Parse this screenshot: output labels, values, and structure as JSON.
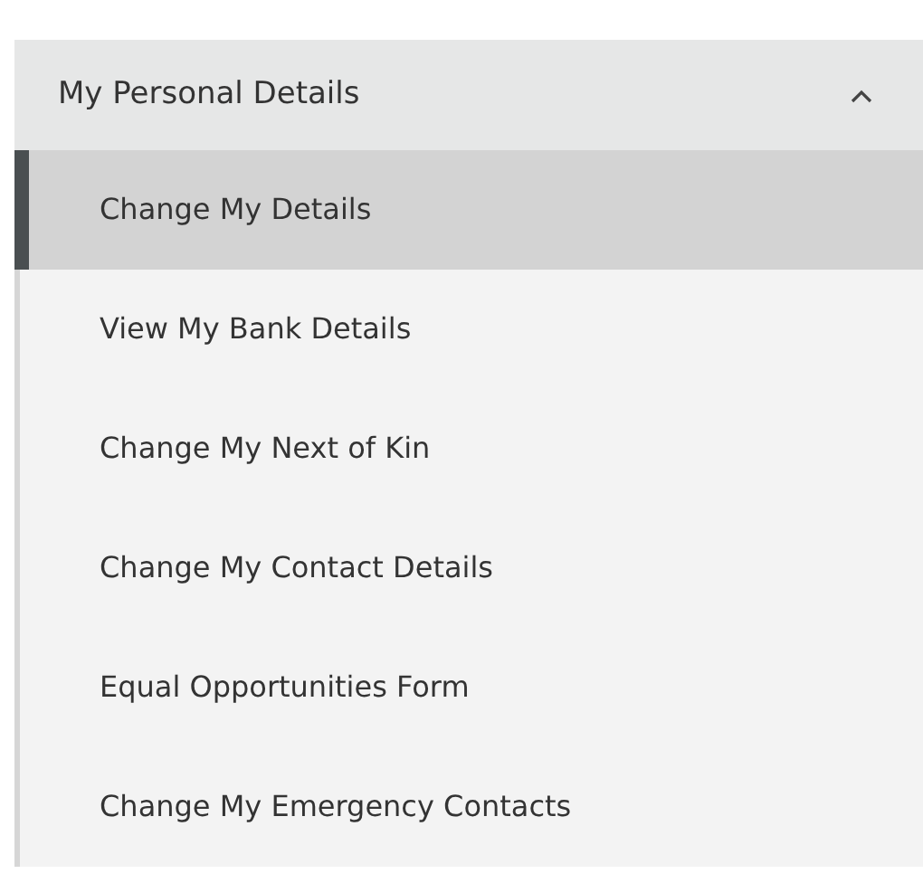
{
  "section": {
    "title": "My Personal Details",
    "expanded": true
  },
  "items": [
    {
      "label": "Change My Details",
      "selected": true
    },
    {
      "label": "View My Bank Details",
      "selected": false
    },
    {
      "label": "Change My Next of Kin",
      "selected": false
    },
    {
      "label": "Change My Contact Details",
      "selected": false
    },
    {
      "label": "Equal Opportunities Form",
      "selected": false
    },
    {
      "label": "Change My Emergency Contacts",
      "selected": false
    }
  ]
}
